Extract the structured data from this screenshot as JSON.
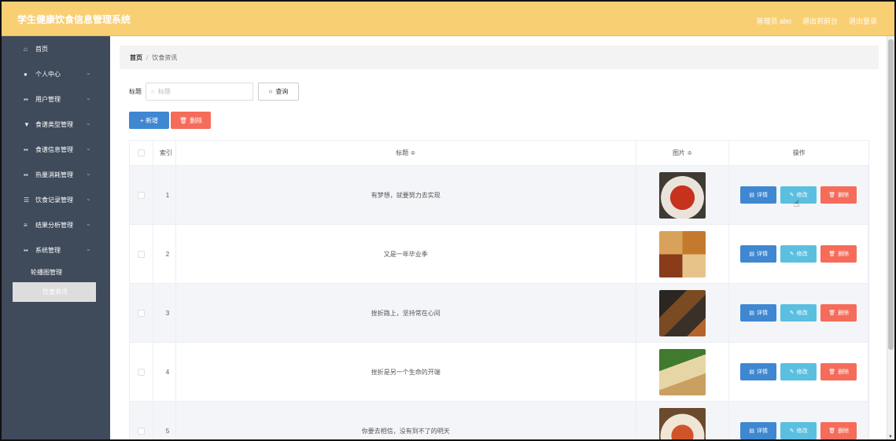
{
  "header": {
    "title": "学生健康饮食信息管理系统",
    "user_label": "管理员 abo",
    "frontend_link": "退出到前台",
    "logout_link": "退出登录"
  },
  "sidebar": {
    "items": [
      {
        "label": "首页",
        "icon": "home-icon"
      },
      {
        "label": "个人中心",
        "icon": "user-icon"
      },
      {
        "label": "用户管理",
        "icon": "grid-icon"
      },
      {
        "label": "食谱类型管理",
        "icon": "filter-icon"
      },
      {
        "label": "食谱信息管理",
        "icon": "grid-icon"
      },
      {
        "label": "热量消耗管理",
        "icon": "grid-icon"
      },
      {
        "label": "饮食记录管理",
        "icon": "sliders-icon"
      },
      {
        "label": "结果分析管理",
        "icon": "list-icon"
      },
      {
        "label": "系统管理",
        "icon": "grid-icon"
      }
    ],
    "sub_items": [
      {
        "label": "轮播图管理"
      },
      {
        "label": "饮食资讯"
      }
    ]
  },
  "breadcrumb": {
    "home": "首页",
    "separator": "/",
    "current": "饮食资讯"
  },
  "search": {
    "label": "标题",
    "placeholder": "标题",
    "button": "查询"
  },
  "actions": {
    "add": "+ 新增",
    "delete": "删除"
  },
  "table": {
    "columns": {
      "index": "索引",
      "title": "标题 ≑",
      "image": "图片 ≑",
      "ops": "操作"
    },
    "rows": [
      {
        "index": "1",
        "title": "有梦想，就要努力去实现"
      },
      {
        "index": "2",
        "title": "又是一年毕业季"
      },
      {
        "index": "3",
        "title": "挫折路上，坚持常在心间"
      },
      {
        "index": "4",
        "title": "挫折是另一个生命的开端"
      },
      {
        "index": "5",
        "title": "你要去相信，没有到不了的明天"
      }
    ],
    "row_buttons": {
      "detail": "详情",
      "edit": "修改",
      "remove": "删除"
    }
  },
  "colors": {
    "header": "#f9cf73",
    "sidebar": "#3f4a5b",
    "primary": "#3f87d1",
    "info": "#5bbfe0",
    "danger": "#f56c5a"
  }
}
